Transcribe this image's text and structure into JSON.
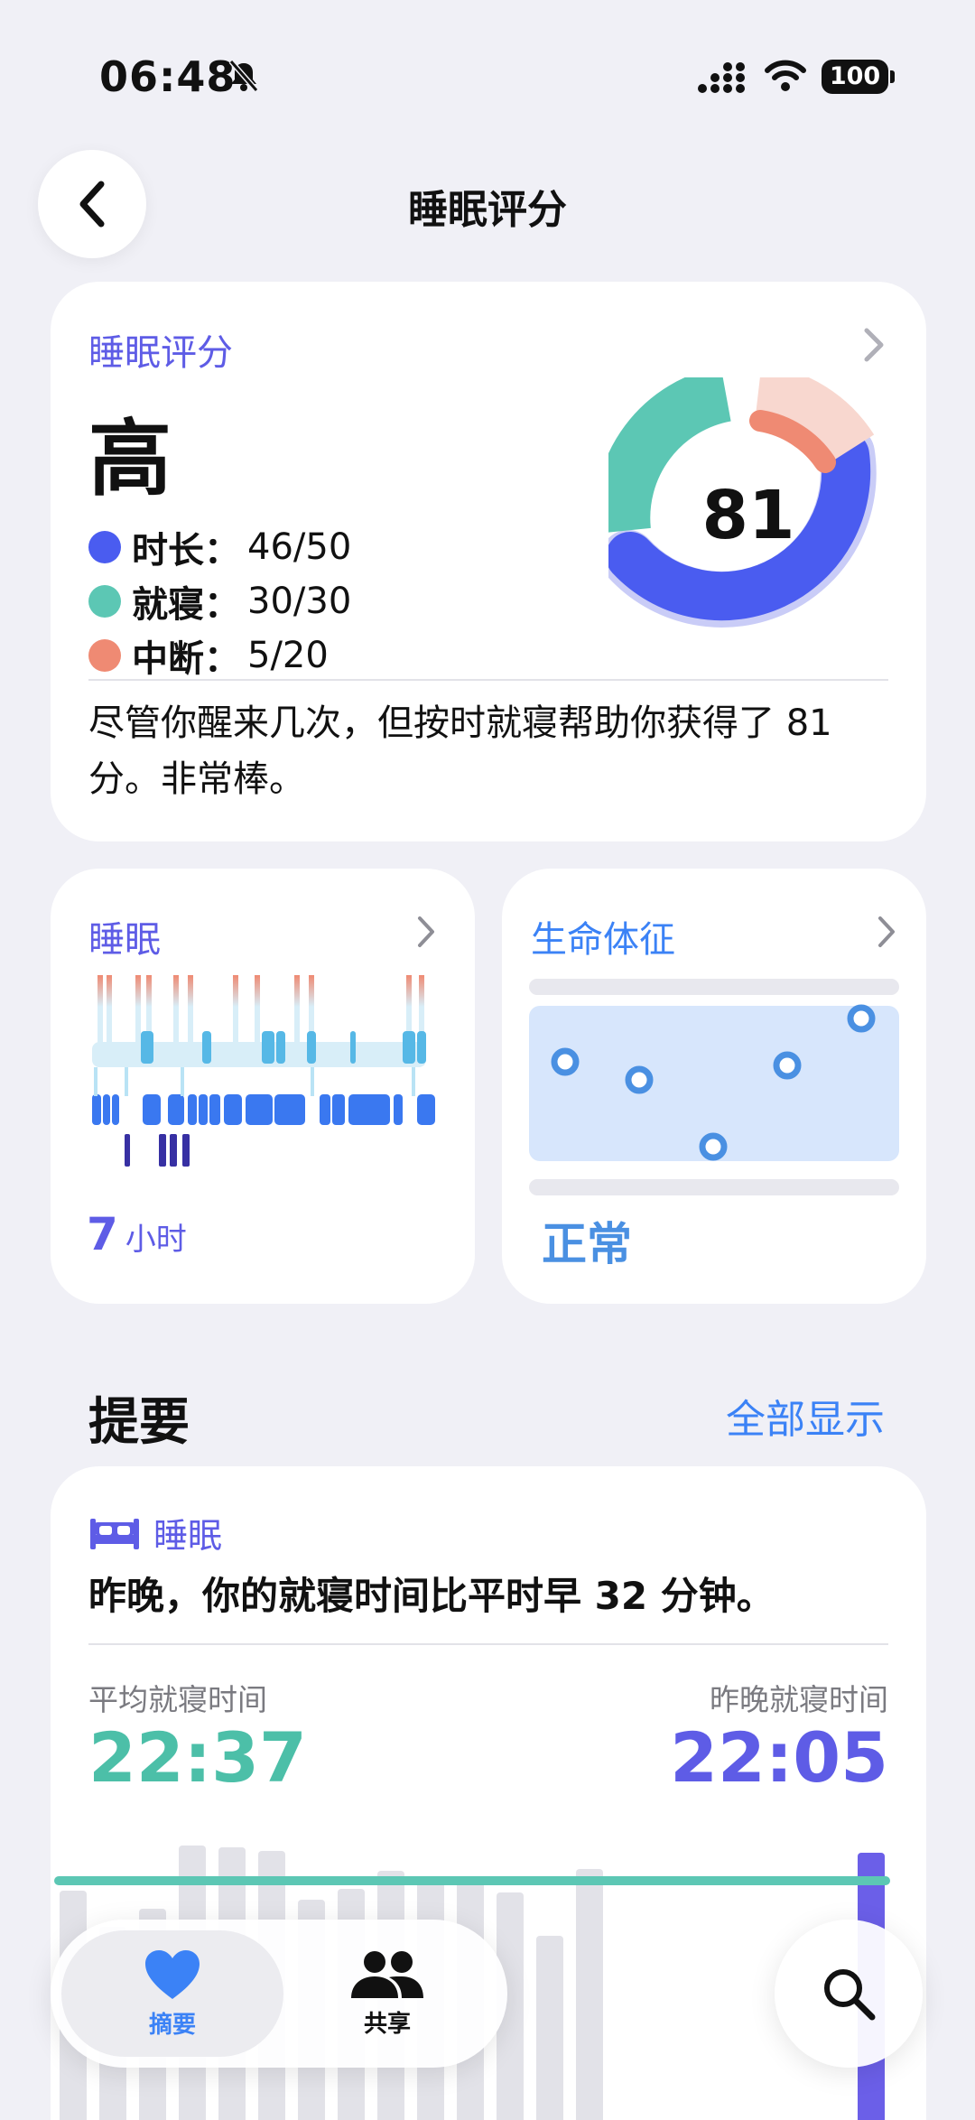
{
  "status": {
    "time": "06:48",
    "battery": "100"
  },
  "nav": {
    "title": "睡眠评分"
  },
  "score_card": {
    "label": "睡眠评分",
    "level": "高",
    "score": "81",
    "legend": [
      {
        "name": "时长：",
        "value": "46/50",
        "color": "#4a5cf0"
      },
      {
        "name": "就寝：",
        "value": "30/30",
        "color": "#5cc7b4"
      },
      {
        "name": "中断：",
        "value": "5/20",
        "color": "#ef8a73"
      }
    ],
    "description": "尽管你醒来几次，但按时就寝帮助你获得了 81分。非常棒。"
  },
  "sleep_card": {
    "label": "睡眠",
    "hours_value": "7",
    "hours_unit": "小时"
  },
  "vitals_card": {
    "label": "生命体征",
    "status": "正常"
  },
  "highlights": {
    "title": "提要",
    "show_all": "全部显示",
    "tag": "睡眠",
    "headline": "昨晚，你的就寝时间比平时早 32 分钟。",
    "avg_label": "平均就寝时间",
    "avg_value": "22:37",
    "last_label": "昨晚就寝时间",
    "last_value": "22:05"
  },
  "tabbar": {
    "summary": "摘要",
    "sharing": "共享"
  },
  "colors": {
    "accent": "#5e5ce6",
    "teal": "#4cbfa8",
    "blue": "#3b82f6",
    "duration": "#4a5cf0",
    "bedtime": "#5cc7b4",
    "interruptions": "#ef8a73"
  }
}
